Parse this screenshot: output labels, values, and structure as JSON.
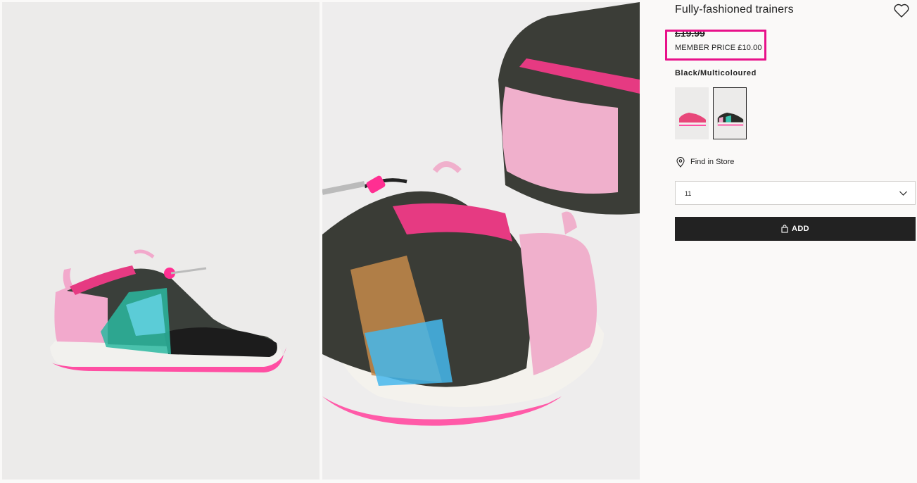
{
  "product": {
    "title": "Fully-fashioned trainers",
    "price": "£19.99",
    "member_price": "MEMBER PRICE £10.00",
    "color_name": "Black/Multicoloured",
    "swatches": [
      {
        "label": "pink trainers",
        "accent": "#e8477a"
      },
      {
        "label": "black/multicoloured trainers",
        "accent": "#1c1c1c",
        "selected": true
      }
    ]
  },
  "actions": {
    "find_in_store": "Find in Store",
    "size_selected": "11",
    "add_label": "ADD"
  },
  "icons": {
    "wishlist": "heart-icon",
    "store": "location-pin-icon",
    "dropdown": "chevron-down-icon",
    "bag": "shopping-bag-icon"
  },
  "colors": {
    "highlight": "#e8118a",
    "button": "#222222",
    "page_background": "#faf9f8"
  }
}
